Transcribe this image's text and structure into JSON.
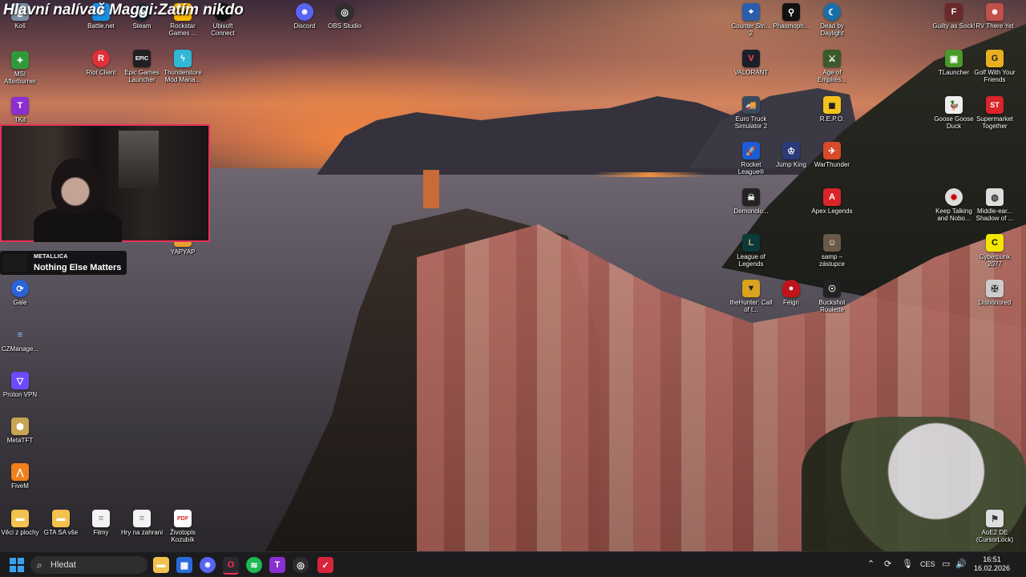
{
  "stream_title": "Hlavní nalívač Maggi:Zatím nikdo",
  "desktop_icons": {
    "trash": "Koš",
    "battlenet": "Battle.net",
    "steam": "Steam",
    "rockstar": "Rockstar Games ...",
    "ubisoft": "Ubisoft Connect",
    "discord": "Discord",
    "obs": "OBS Studio",
    "msi": "MSI Afterburner",
    "riot": "Riot Client",
    "epic": "Epic Games Launcher",
    "thunderstore": "Thunderstore Mod Mana...",
    "tkit": "TKit",
    "yapyap": "YAPYAP",
    "gale": "Gale",
    "czmanager": "CZManage...",
    "protonvpn": "Proton VPN",
    "metatft": "MetaTFT",
    "fivem": "FiveM",
    "veci": "Věci z plochy",
    "gtasa": "GTA SA vše",
    "filmy": "Filmy",
    "hry": "Hry na zahrani",
    "zivotopis": "Životopis Kozubík",
    "counterstrike": "Counter Stri... 2",
    "phasmophobia": "Phasmoph...",
    "dbd": "Dead by Daylight",
    "valorant": "VALORANT",
    "aoe": "Age of Empires...",
    "ets2": "Euro Truck Simulator 2",
    "repo": "R.E.P.O.",
    "rocketleague": "Rocket League®",
    "jumpking": "Jump King",
    "warthunder": "WarThunder",
    "demonologist": "Demonolo...",
    "apex": "Apex Legends",
    "lol": "League of Legends",
    "samp": "samp – zástupce",
    "thehunter": "theHunter: Call of t...",
    "feign": "Feign",
    "buckshot": "Buckshot Roulette",
    "guiltyassock": "Guilty as Sock!",
    "rvthereyet": "RV There Yet",
    "tlauncher": "TLauncher",
    "golf": "Golf With Your Friends",
    "goosegoose": "Goose Goose Duck",
    "supermarket": "Supermarket Together",
    "keeptalking": "Keep Talking and Nobo...",
    "middleearth": "Middle-ear... Shadow of ...",
    "cyberpunk": "Cyberpunk 2077",
    "dishonored": "Dishonored",
    "aoe2de": "AoE2 DE (CursorLock)"
  },
  "now_playing": {
    "artist": "METALLICA",
    "song": "Nothing Else Matters"
  },
  "taskbar": {
    "search_label": "Hledat",
    "language": "CES",
    "time": "16:51",
    "date": "16.02.2026"
  },
  "colors": {
    "webcam_border": "#e6325a",
    "taskbar_bg": "#1c1c1e",
    "start_blue": "#3aa0f0"
  }
}
